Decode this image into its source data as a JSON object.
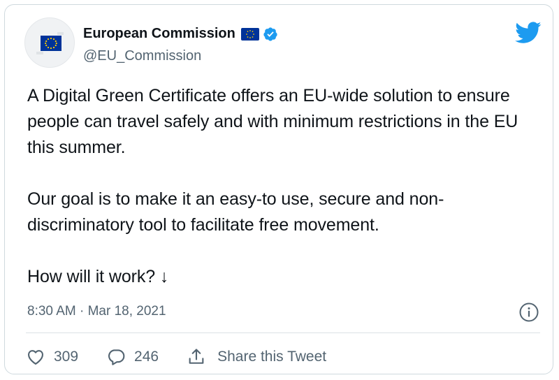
{
  "author": {
    "name": "European Commission",
    "handle": "@EU_Commission",
    "verified": true,
    "avatar_icon": "eu-flag-icon",
    "flag_icon": "eu-flag-icon"
  },
  "tweet": {
    "paragraphs": [
      "A Digital Green Certificate offers an EU-wide solution to ensure people can travel safely and with minimum restrictions in the EU this summer.",
      "Our goal is to make it an easy-to use, secure and non-discriminatory tool to facilitate free movement.",
      "How will it work? ↓"
    ],
    "time": "8:30 AM",
    "separator": " · ",
    "date": "Mar 18, 2021"
  },
  "actions": {
    "likes": "309",
    "replies": "246",
    "share_label": "Share this Tweet"
  },
  "colors": {
    "twitter_blue": "#1d9bf0",
    "eu_blue": "#003399",
    "eu_yellow": "#ffcc00",
    "secondary_text": "#536471"
  }
}
